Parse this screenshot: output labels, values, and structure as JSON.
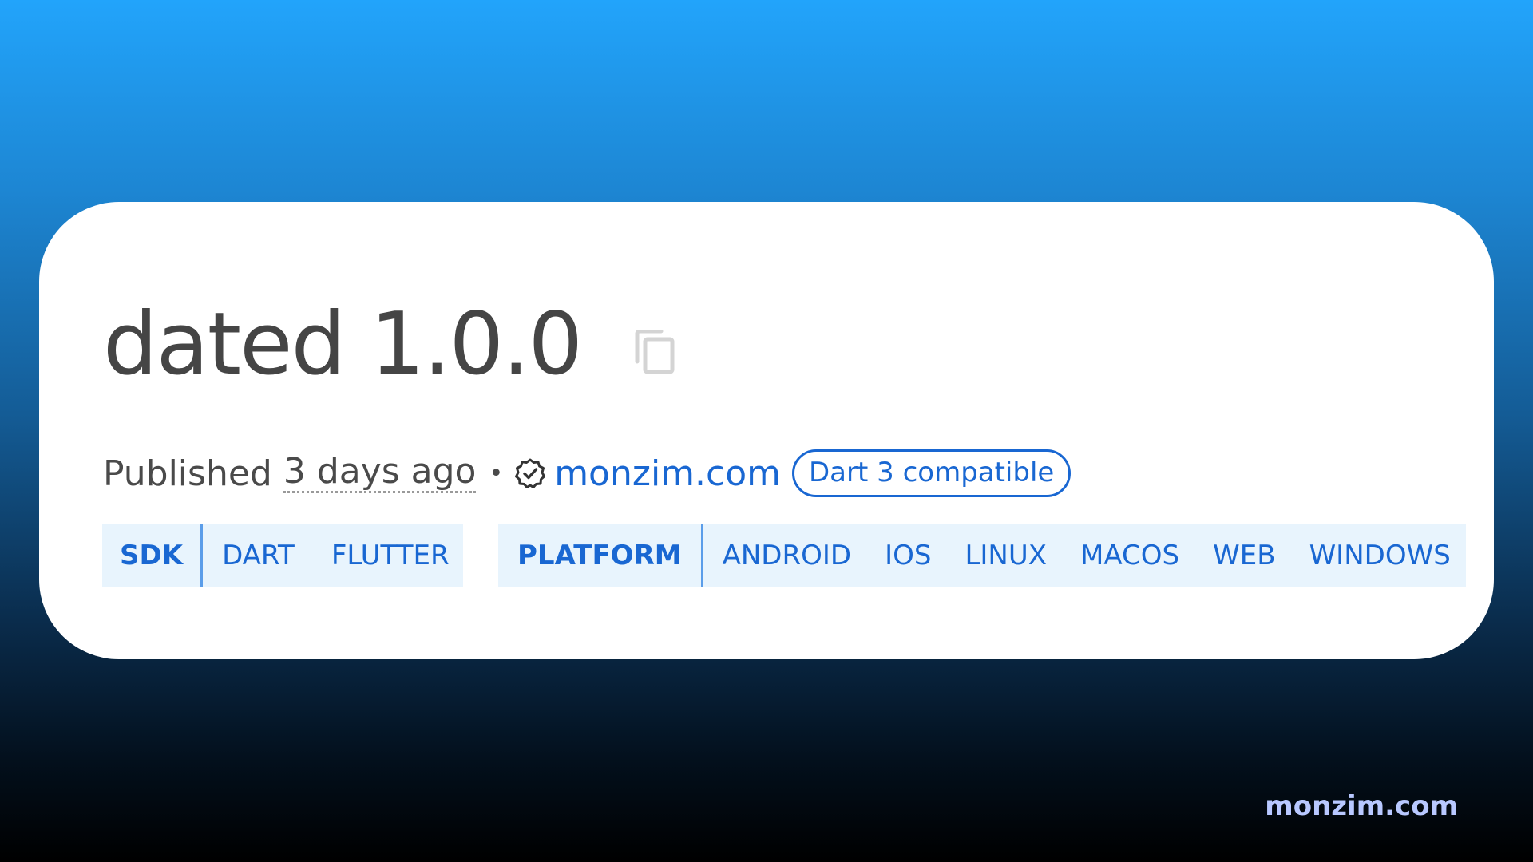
{
  "package": {
    "title": "dated 1.0.0",
    "copy_icon": "copy-icon"
  },
  "meta": {
    "published_label": "Published",
    "published_time": "3 days ago",
    "separator": "•",
    "verified_icon": "verified-publisher-icon",
    "publisher": "monzim.com",
    "compat_badge": "Dart 3 compatible"
  },
  "tags": {
    "sdk": {
      "label": "SDK",
      "items": [
        "DART",
        "FLUTTER"
      ]
    },
    "platform": {
      "label": "PLATFORM",
      "items": [
        "ANDROID",
        "IOS",
        "LINUX",
        "MACOS",
        "WEB",
        "WINDOWS"
      ]
    }
  },
  "watermark": "monzim.com",
  "colors": {
    "accent": "#1967d2",
    "tag_background": "#e8f4fd",
    "title_text": "#454545",
    "watermark": "#b8c8ff"
  }
}
